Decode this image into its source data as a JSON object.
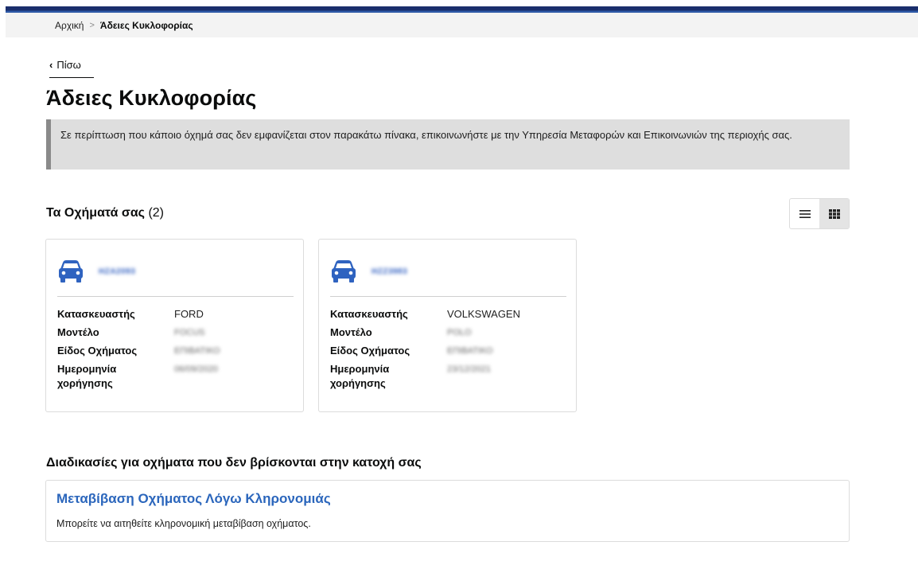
{
  "breadcrumb": {
    "home": "Αρχική",
    "separator": ">",
    "current": "Άδειες Κυκλοφορίας"
  },
  "back": {
    "label": "Πίσω"
  },
  "page": {
    "title": "Άδειες Κυκλοφορίας",
    "notice": "Σε περίπτωση που κάποιο όχημά σας δεν εμφανίζεται στον παρακάτω πίνακα, επικοινωνήστε με την Υπηρεσία Μεταφορών και Επικοινωνιών της περιοχής σας."
  },
  "vehicles_section": {
    "heading": "Τα Οχήματά σας",
    "count": "(2)"
  },
  "view_toggle": {
    "list_icon": "list-view-icon",
    "grid_icon": "grid-view-icon",
    "active": "grid"
  },
  "labels": {
    "manufacturer": "Κατασκευαστής",
    "model": "Μοντέλο",
    "type": "Είδος Οχήματος",
    "date": "Ημερομηνία χορήγησης"
  },
  "vehicles": [
    {
      "plate": "ΗΖΑ2093",
      "manufacturer": "FORD",
      "model": "FOCUS",
      "type": "ΕΠΙΒΑΤΙΚΟ",
      "date": "06/09/2020"
    },
    {
      "plate": "ΗΖΖ3983",
      "manufacturer": "VOLKSWAGEN",
      "model": "POLO",
      "type": "ΕΠΙΒΑΤΙΚΟ",
      "date": "23/12/2021"
    }
  ],
  "procedures": {
    "heading": "Διαδικασίες για οχήματα που δεν βρίσκονται στην κατοχή σας",
    "items": [
      {
        "title": "Μεταβίβαση Οχήματος Λόγω Κληρονομιάς",
        "description": "Μπορείτε να αιτηθείτε κληρονομική μεταβίβαση οχήματος."
      }
    ]
  },
  "colors": {
    "brand_dark": "#1a2e6c",
    "brand_link": "#2b66bc",
    "icon": "#2f63c0"
  }
}
